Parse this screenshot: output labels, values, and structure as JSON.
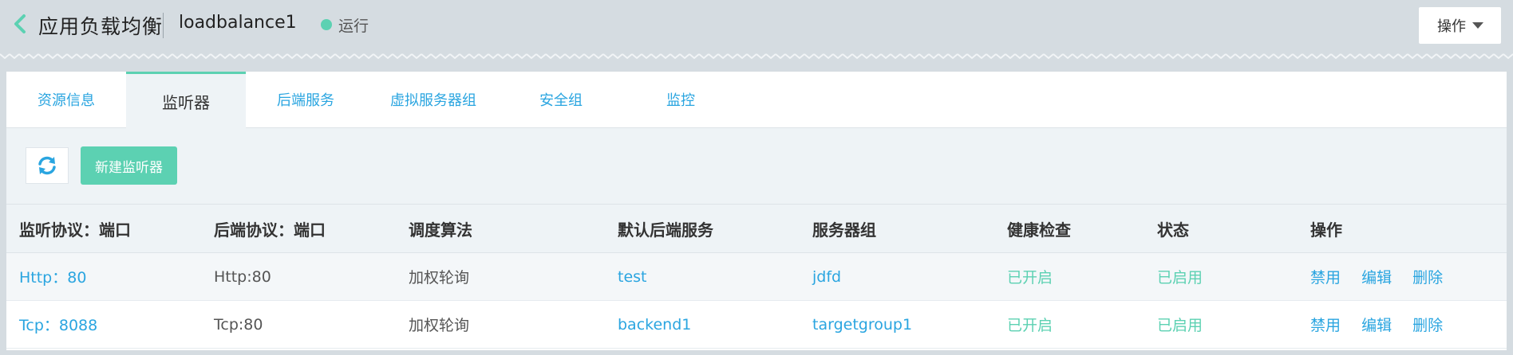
{
  "header": {
    "title": "应用负载均衡",
    "instance_name": "loadbalance1",
    "status": "运行",
    "action_label": "操作"
  },
  "tabs": [
    {
      "label": "资源信息",
      "active": false
    },
    {
      "label": "监听器",
      "active": true
    },
    {
      "label": "后端服务",
      "active": false
    },
    {
      "label": "虚拟服务器组",
      "active": false
    },
    {
      "label": "安全组",
      "active": false
    },
    {
      "label": "监控",
      "active": false
    }
  ],
  "toolbar": {
    "refresh_icon": "refresh-icon",
    "create_label": "新建监听器"
  },
  "table": {
    "headers": [
      "监听协议：端口",
      "后端协议：端口",
      "调度算法",
      "默认后端服务",
      "服务器组",
      "健康检查",
      "状态",
      "操作"
    ],
    "rows": [
      {
        "listener": "Http：80",
        "backend_protocol": "Http:80",
        "algorithm": "加权轮询",
        "default_backend": "test",
        "server_group": "jdfd",
        "health_check": "已开启",
        "status": "已启用",
        "ops": [
          "禁用",
          "编辑",
          "删除"
        ]
      },
      {
        "listener": "Tcp：8088",
        "backend_protocol": "Tcp:80",
        "algorithm": "加权轮询",
        "default_backend": "backend1",
        "server_group": "targetgroup1",
        "health_check": "已开启",
        "status": "已启用",
        "ops": [
          "禁用",
          "编辑",
          "删除"
        ]
      }
    ]
  },
  "colors": {
    "accent_green": "#5cd1b2",
    "link_blue": "#2aa5e0",
    "header_bg": "#d5dce1"
  }
}
